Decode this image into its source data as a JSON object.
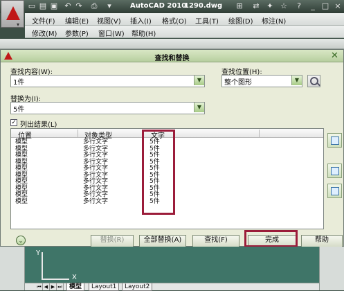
{
  "app": {
    "title": "AutoCAD 2010",
    "file": "1290.dwg",
    "logo": "autocad-logo"
  },
  "menu_row1": [
    "文件(F)",
    "编辑(E)",
    "视图(V)",
    "插入(I)",
    "格式(O)",
    "工具(T)",
    "绘图(D)",
    "标注(N)"
  ],
  "menu_row2": [
    "修改(M)",
    "参数(P)",
    "窗口(W)",
    "帮助(H)"
  ],
  "dialog": {
    "title": "查找和替换",
    "find_label": "查找内容(W):",
    "find_value": "1件",
    "replace_label": "替换为(I):",
    "replace_value": "5件",
    "location_label": "查找位置(H):",
    "location_value": "整个图形",
    "list_results_label": "列出结果(L)",
    "list_results_checked": true,
    "columns": [
      "位置",
      "对象类型",
      "文字"
    ],
    "rows": [
      [
        "模型",
        "多行文字",
        "5件"
      ],
      [
        "模型",
        "多行文字",
        "5件"
      ],
      [
        "模型",
        "多行文字",
        "5件"
      ],
      [
        "模型",
        "多行文字",
        "5件"
      ],
      [
        "模型",
        "多行文字",
        "5件"
      ],
      [
        "模型",
        "多行文字",
        "5件"
      ],
      [
        "模型",
        "多行文字",
        "5件"
      ],
      [
        "模型",
        "多行文字",
        "5件"
      ],
      [
        "模型",
        "多行文字",
        "5件"
      ],
      [
        "模型",
        "多行文字",
        "5件"
      ]
    ],
    "buttons": {
      "replace": "替换(R)",
      "replace_all": "全部替换(A)",
      "find": "查找(F)",
      "done": "完成",
      "help": "帮助"
    },
    "highlight_color": "#9b1c3a"
  },
  "ucs": {
    "x": "X",
    "y": "Y"
  },
  "layout_tabs": [
    "模型",
    "Layout1",
    "Layout2"
  ]
}
